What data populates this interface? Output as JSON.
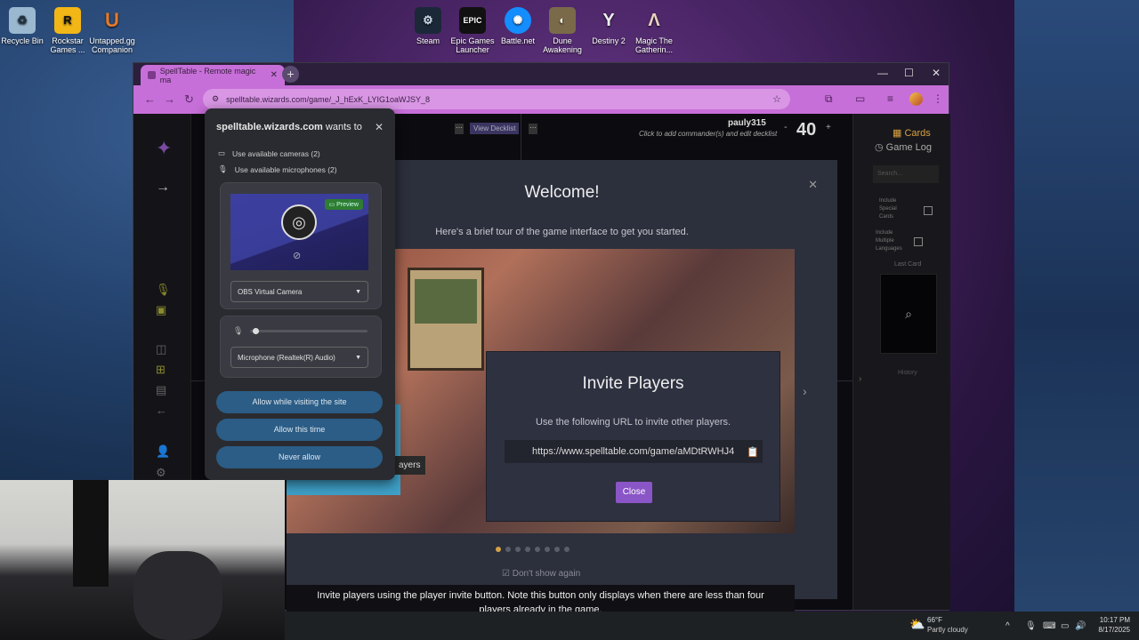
{
  "desktop": {
    "icons": [
      {
        "label": "Recycle Bin",
        "icon": "recycle-bin-icon"
      },
      {
        "label": "Rockstar Games ...",
        "icon": "rockstar-icon"
      },
      {
        "label": "Untapped.gg Companion",
        "icon": "untapped-icon"
      },
      {
        "label": "Steam",
        "icon": "steam-icon"
      },
      {
        "label": "Epic Games Launcher",
        "icon": "epic-icon"
      },
      {
        "label": "Battle.net",
        "icon": "battlenet-icon"
      },
      {
        "label": "Dune Awakening",
        "icon": "dune-icon"
      },
      {
        "label": "Destiny 2",
        "icon": "destiny-icon"
      },
      {
        "label": "Magic The Gatherin...",
        "icon": "mtg-icon"
      }
    ]
  },
  "browser": {
    "tab_title": "SpellTable - Remote magic ma",
    "url": "spelltable.wizards.com/game/_J_hExK_LYIG1oaWJSY_8"
  },
  "game": {
    "player_name": "pauly315",
    "commander_hint": "Click to add commander(s) and edit decklist",
    "life": "40",
    "minus": "-",
    "plus": "+",
    "view_decklist": "View Decklist",
    "cards_tab": "Cards",
    "game_log_tab": "Game Log",
    "search_placeholder": "Search...",
    "include_special": "Include Special Cards",
    "include_multiple": "Include Multiple Languages",
    "last_card": "Last Card",
    "history": "History"
  },
  "welcome": {
    "title": "Welcome!",
    "subtitle": "Here's a brief tour of the game interface to get you started.",
    "invite_title": "Invite Players",
    "invite_note": "Use the following URL to invite other players.",
    "invite_url": "https://www.spelltable.com/game/aMDtRWHJ4",
    "close": "Close",
    "side_label": "ayers",
    "caption": "Invite players using the player invite button. Note this button only displays when there are less than four players already in the game.",
    "dont_show": "Don't show again",
    "dots": 8,
    "active_dot": 0
  },
  "permission": {
    "site": "spelltable.wizards.com",
    "wants_to": "wants to",
    "cameras": "Use available cameras (2)",
    "microphones": "Use available microphones (2)",
    "preview_tag": "Preview",
    "camera_select": "OBS Virtual Camera",
    "mic_select": "Microphone (Realtek(R) Audio)",
    "allow_visiting": "Allow while visiting the site",
    "allow_once": "Allow this time",
    "never": "Never allow",
    "mic_level": 0.02
  },
  "taskbar": {
    "temp": "66°F",
    "weather": "Partly cloudy",
    "time": "10:17 PM",
    "date": "8/17/2025"
  }
}
